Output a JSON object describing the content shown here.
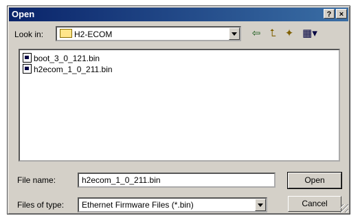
{
  "window": {
    "title": "Open",
    "help_label": "?",
    "close_label": "×"
  },
  "lookin": {
    "label": "Look in:",
    "folder": "H2-ECOM"
  },
  "toolbar": {
    "back_icon": "⇦",
    "up_icon": "⮤",
    "newfolder_icon": "✦",
    "view_icon": "▦▾"
  },
  "files": [
    {
      "name": "boot_3_0_121.bin"
    },
    {
      "name": "h2ecom_1_0_211.bin"
    }
  ],
  "filename": {
    "label": "File name:",
    "value": "h2ecom_1_0_211.bin"
  },
  "filetype": {
    "label": "Files of type:",
    "value": "Ethernet Firmware Files (*.bin)"
  },
  "buttons": {
    "open": "Open",
    "cancel": "Cancel"
  }
}
